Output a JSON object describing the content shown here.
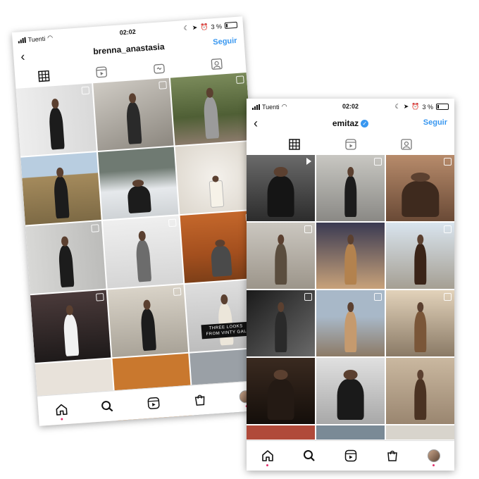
{
  "left": {
    "status": {
      "carrier": "Tuenti",
      "time": "02:02",
      "battery": "3 %"
    },
    "header": {
      "username": "brenna_anastasia",
      "follow_label": "Seguir",
      "verified": false
    },
    "tab_icons": [
      "grid-icon",
      "reels-icon",
      "igtv-icon",
      "tagged-icon"
    ],
    "overlay_text": "THREE LOOKS FROM VINTY GAL",
    "nav_icons": [
      "home-icon",
      "search-icon",
      "reels-icon",
      "shop-icon",
      "profile-avatar"
    ]
  },
  "right": {
    "status": {
      "carrier": "Tuenti",
      "time": "02:02",
      "battery": "3 %"
    },
    "header": {
      "username": "emitaz",
      "follow_label": "Seguir",
      "verified": true
    },
    "tab_icons": [
      "grid-icon",
      "reels-icon",
      "tagged-icon"
    ],
    "nav_icons": [
      "home-icon",
      "search-icon",
      "reels-icon",
      "shop-icon",
      "profile-avatar"
    ]
  },
  "colors": {
    "accent": "#3897f0",
    "text": "#111111",
    "notification": "#e1306c"
  }
}
